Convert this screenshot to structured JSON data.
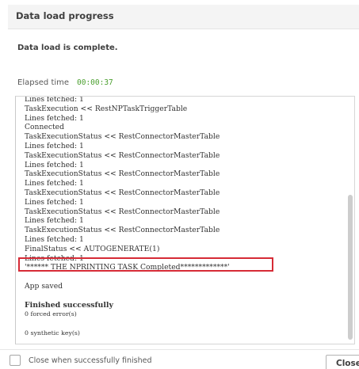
{
  "dialog": {
    "title": "Data load progress",
    "status_text": "Data load is complete.",
    "elapsed_label": "Elapsed time",
    "elapsed_value": "00:00:37"
  },
  "log": {
    "lines": [
      {
        "text": "Lines fetched: 1",
        "style": "normal"
      },
      {
        "text": "TaskExecution << RestNPTaskTriggerTable",
        "style": "normal"
      },
      {
        "text": "Lines fetched: 1",
        "style": "normal"
      },
      {
        "text": "Connected",
        "style": "normal"
      },
      {
        "text": "TaskExecutionStatus << RestConnectorMasterTable",
        "style": "normal"
      },
      {
        "text": "Lines fetched: 1",
        "style": "normal"
      },
      {
        "text": "TaskExecutionStatus << RestConnectorMasterTable",
        "style": "normal"
      },
      {
        "text": "Lines fetched: 1",
        "style": "normal"
      },
      {
        "text": "TaskExecutionStatus << RestConnectorMasterTable",
        "style": "normal"
      },
      {
        "text": "Lines fetched: 1",
        "style": "normal"
      },
      {
        "text": "TaskExecutionStatus << RestConnectorMasterTable",
        "style": "normal"
      },
      {
        "text": "Lines fetched: 1",
        "style": "normal"
      },
      {
        "text": "TaskExecutionStatus << RestConnectorMasterTable",
        "style": "normal"
      },
      {
        "text": "Lines fetched: 1",
        "style": "normal"
      },
      {
        "text": "TaskExecutionStatus << RestConnectorMasterTable",
        "style": "normal"
      },
      {
        "text": "Lines fetched: 1",
        "style": "normal"
      },
      {
        "text": "FinalStatus << AUTOGENERATE(1)",
        "style": "normal"
      },
      {
        "text": "Lines fetched: 1",
        "style": "normal"
      },
      {
        "text": "'****** THE NPRINTING TASK Completed*************'",
        "style": "normal"
      },
      {
        "text": "",
        "style": "normal"
      },
      {
        "text": "App saved",
        "style": "normal"
      },
      {
        "text": "",
        "style": "normal"
      },
      {
        "text": "Finished successfully",
        "style": "bold"
      },
      {
        "text": "0 forced error(s)",
        "style": "small"
      },
      {
        "text": "",
        "style": "small"
      },
      {
        "text": "0 synthetic key(s)",
        "style": "small"
      }
    ],
    "highlighted_line_index": 18,
    "highlight_color": "#d62b36"
  },
  "footer": {
    "checkbox_label": "Close when successfully finished",
    "checkbox_checked": false,
    "close_button_label": "Close"
  },
  "colors": {
    "elapsed_value": "#4a9f2e",
    "header_background": "#f4f4f4",
    "highlight_border": "#d62b36"
  }
}
